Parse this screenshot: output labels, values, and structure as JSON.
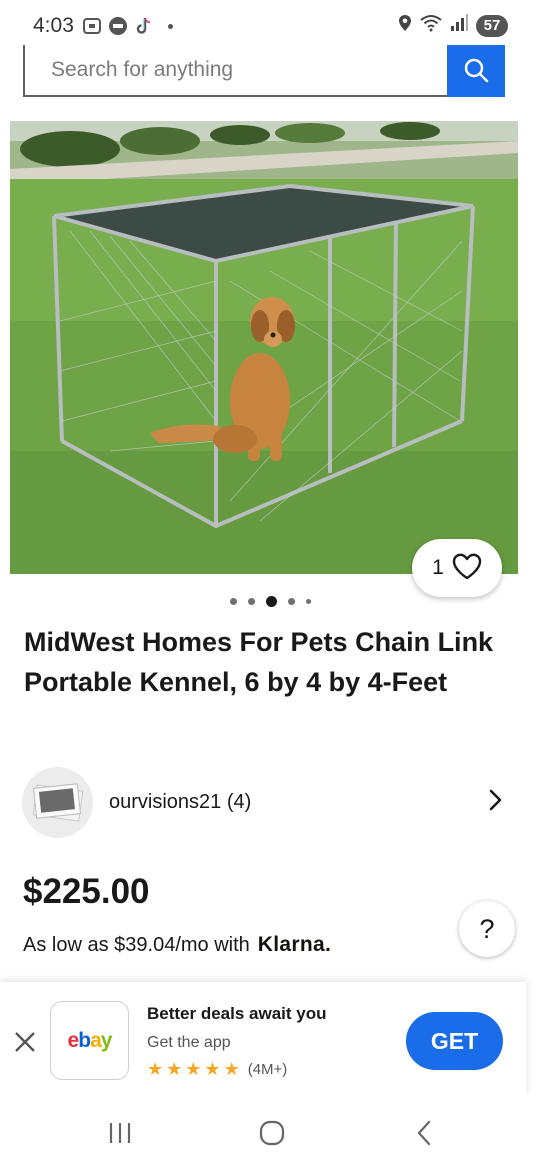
{
  "status_bar": {
    "time": "4:03",
    "battery": "57",
    "left_icons": [
      "screenshot-icon",
      "news-icon",
      "tiktok-icon",
      "dot-icon"
    ],
    "right_icons": [
      "location-icon",
      "wifi-icon",
      "signal-icon",
      "battery-icon"
    ]
  },
  "search": {
    "placeholder": "Search for anything"
  },
  "listing": {
    "image_alt": "Dog in chain link kennel on grass",
    "watch_count": "1",
    "pager": {
      "count": 5,
      "active_index": 2
    },
    "title": "MidWest Homes For Pets Chain Link Portable Kennel, 6 by 4 by 4-Feet",
    "seller": {
      "name": "ourvisions21 (4)"
    },
    "price": "$225.00",
    "financing_text": "As low as $39.04/mo with",
    "financing_brand": "Klarna."
  },
  "help": {
    "label": "?"
  },
  "app_banner": {
    "logo_text": [
      "e",
      "b",
      "a",
      "y"
    ],
    "logo_colors": [
      "#e53238",
      "#0064d2",
      "#f5af02",
      "#86b817"
    ],
    "headline": "Better deals await you",
    "subtitle": "Get the app",
    "rating_stars": 5,
    "rating_count": "(4M+)",
    "get_label": "GET"
  },
  "colors": {
    "accent": "#1a6ce8",
    "star": "#f5a623"
  },
  "nav": [
    "recent-apps",
    "home",
    "back"
  ]
}
